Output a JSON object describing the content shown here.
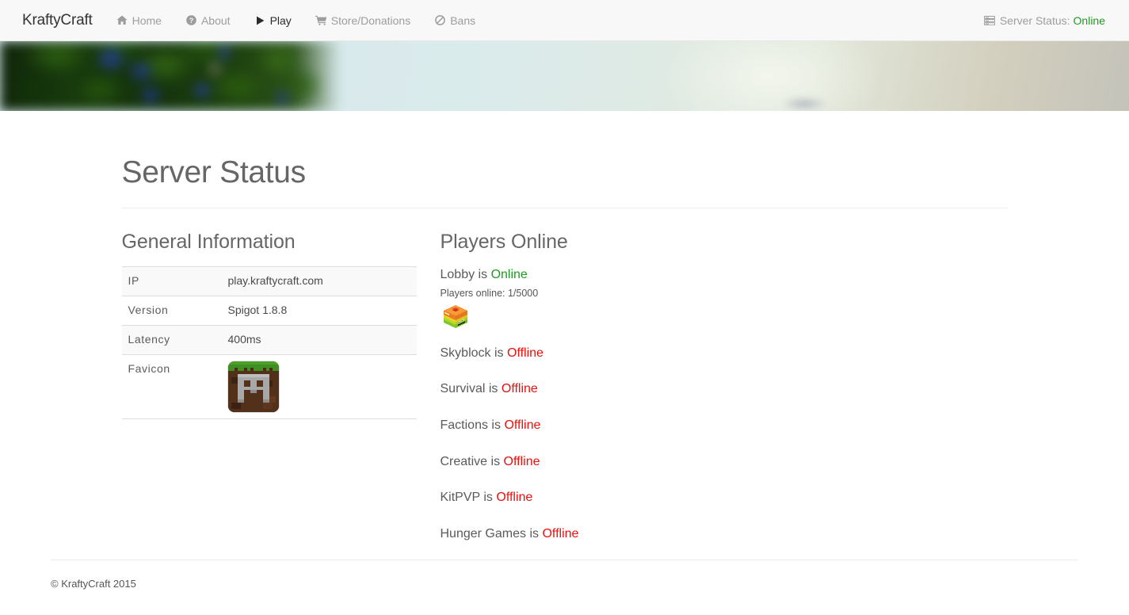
{
  "navbar": {
    "brand": "KraftyCraft",
    "items": [
      {
        "label": "Home",
        "icon": "home-icon",
        "active": false
      },
      {
        "label": "About",
        "icon": "question-circle-icon",
        "active": false
      },
      {
        "label": "Play",
        "icon": "play-icon",
        "active": true
      },
      {
        "label": "Store/Donations",
        "icon": "cart-icon",
        "active": false
      },
      {
        "label": "Bans",
        "icon": "ban-icon",
        "active": false
      }
    ],
    "status_icon": "server-icon",
    "status_label": "Server Status:",
    "status_value": "Online"
  },
  "page": {
    "title": "Server Status"
  },
  "general_information": {
    "heading": "General Information",
    "rows": [
      {
        "label": "IP",
        "value": "play.kraftycraft.com"
      },
      {
        "label": "Version",
        "value": "Spigot 1.8.8"
      },
      {
        "label": "Latency",
        "value": "400ms"
      },
      {
        "label": "Favicon",
        "value": "",
        "icon": "minecraft-grass-block-favicon"
      }
    ]
  },
  "players_online": {
    "heading": "Players Online",
    "servers": [
      {
        "name": "Lobby",
        "is": "is",
        "state": "Online",
        "state_kind": "online",
        "players_text": "Players online: 1/5000",
        "heads": [
          "minecraft-player-head-rainbow"
        ]
      },
      {
        "name": "Skyblock",
        "is": "is",
        "state": "Offline",
        "state_kind": "offline"
      },
      {
        "name": "Survival",
        "is": "is",
        "state": "Offline",
        "state_kind": "offline"
      },
      {
        "name": "Factions",
        "is": "is",
        "state": "Offline",
        "state_kind": "offline"
      },
      {
        "name": "Creative",
        "is": "is",
        "state": "Offline",
        "state_kind": "offline"
      },
      {
        "name": "KitPVP",
        "is": "is",
        "state": "Offline",
        "state_kind": "offline"
      },
      {
        "name": "Hunger Games",
        "is": "is",
        "state": "Offline",
        "state_kind": "offline"
      }
    ]
  },
  "footer": {
    "copyright": "© KraftyCraft 2015"
  },
  "colors": {
    "online": "#1f9b22",
    "offline": "#e8100d",
    "navbar_bg": "#f8f8f8",
    "nav_text": "#9d9d9d",
    "nav_active": "#2b2b2b",
    "heading": "#666666"
  }
}
